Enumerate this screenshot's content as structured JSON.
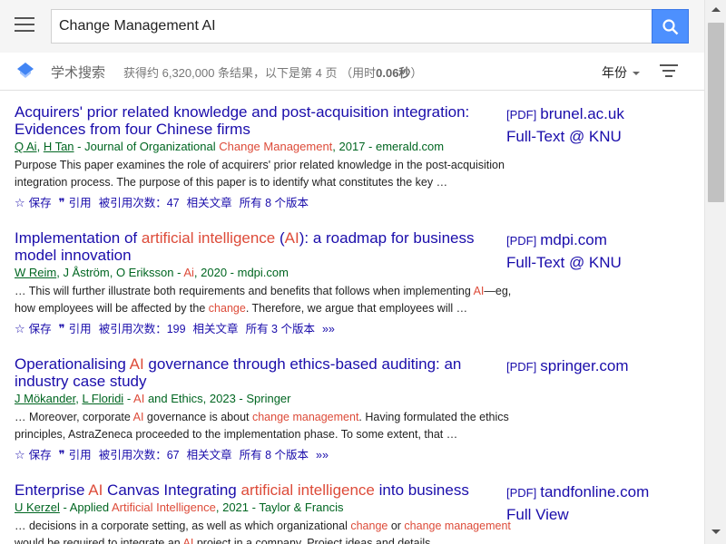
{
  "search": {
    "query": "Change Management AI",
    "button": "search-icon"
  },
  "header": {
    "brand": "学术搜索",
    "stats_prefix": "获得约 6,320,000 条结果，以下是第 4 页 （用时",
    "stats_time": "0.06秒",
    "stats_suffix": "）",
    "year_label": "年份"
  },
  "results": [
    {
      "title": [
        {
          "t": "Acquirers' prior related knowledge and post-acquisition integration: Evidences from four Chinese firms",
          "h": false
        }
      ],
      "authors": [
        {
          "t": "Q Ai",
          "u": true,
          "h": false
        },
        {
          "t": ", ",
          "u": false,
          "h": false
        },
        {
          "t": "H Tan",
          "u": true,
          "h": false
        },
        {
          "t": " - Journal of Organizational ",
          "u": false,
          "h": false
        },
        {
          "t": "Change Management",
          "u": false,
          "h": true
        },
        {
          "t": ", 2017 - emerald.com",
          "u": false,
          "h": false
        }
      ],
      "snippet": [
        {
          "t": "Purpose This paper examines the role of acquirers' prior related knowledge in the post-acquisition integration process. The purpose of this paper is to identify what constitutes the key …",
          "h": false
        }
      ],
      "links": {
        "save": "保存",
        "cite": "引用",
        "cited_by": "被引用次数：47",
        "related": "相关文章",
        "versions": "所有 8 个版本",
        "more": ""
      },
      "side": {
        "pdf": "[PDF]",
        "source": "brunel.ac.uk",
        "extra": "Full-Text @ KNU"
      }
    },
    {
      "title": [
        {
          "t": "Implementation of ",
          "h": false
        },
        {
          "t": "artificial intelligence",
          "h": true
        },
        {
          "t": " (",
          "h": false
        },
        {
          "t": "AI",
          "h": true
        },
        {
          "t": "): a roadmap for business model innovation",
          "h": false
        }
      ],
      "authors": [
        {
          "t": "W Reim",
          "u": true,
          "h": false
        },
        {
          "t": ", J Åström, O Eriksson - ",
          "u": false,
          "h": false
        },
        {
          "t": "Ai",
          "u": false,
          "h": true
        },
        {
          "t": ", 2020 - mdpi.com",
          "u": false,
          "h": false
        }
      ],
      "snippet": [
        {
          "t": "… This will further illustrate both requirements and benefits that follows when implementing ",
          "h": false
        },
        {
          "t": "AI",
          "h": true
        },
        {
          "t": "—eg, how employees will be affected by the ",
          "h": false
        },
        {
          "t": "change",
          "h": true
        },
        {
          "t": ". Therefore, we argue that employees will …",
          "h": false
        }
      ],
      "links": {
        "save": "保存",
        "cite": "引用",
        "cited_by": "被引用次数：199",
        "related": "相关文章",
        "versions": "所有 3 个版本",
        "more": "»»"
      },
      "side": {
        "pdf": "[PDF]",
        "source": "mdpi.com",
        "extra": "Full-Text @ KNU"
      }
    },
    {
      "title": [
        {
          "t": "Operationalising ",
          "h": false
        },
        {
          "t": "AI",
          "h": true
        },
        {
          "t": " governance through ethics-based auditing: an industry case study",
          "h": false
        }
      ],
      "authors": [
        {
          "t": "J Mökander",
          "u": true,
          "h": false
        },
        {
          "t": ", ",
          "u": false,
          "h": false
        },
        {
          "t": "L Floridi",
          "u": true,
          "h": false
        },
        {
          "t": " - ",
          "u": false,
          "h": false
        },
        {
          "t": "AI",
          "u": false,
          "h": true
        },
        {
          "t": " and Ethics, 2023 - Springer",
          "u": false,
          "h": false
        }
      ],
      "snippet": [
        {
          "t": "… Moreover, corporate ",
          "h": false
        },
        {
          "t": "AI",
          "h": true
        },
        {
          "t": " governance is about ",
          "h": false
        },
        {
          "t": "change management",
          "h": true
        },
        {
          "t": ". Having formulated the ethics principles, AstraZeneca proceeded to the implementation phase. To some extent, that …",
          "h": false
        }
      ],
      "links": {
        "save": "保存",
        "cite": "引用",
        "cited_by": "被引用次数：67",
        "related": "相关文章",
        "versions": "所有 8 个版本",
        "more": "»»"
      },
      "side": {
        "pdf": "[PDF]",
        "source": "springer.com",
        "extra": ""
      }
    },
    {
      "title": [
        {
          "t": "Enterprise ",
          "h": false
        },
        {
          "t": "AI",
          "h": true
        },
        {
          "t": " Canvas Integrating ",
          "h": false
        },
        {
          "t": "artificial intelligence",
          "h": true
        },
        {
          "t": " into business",
          "h": false
        }
      ],
      "authors": [
        {
          "t": "U Kerzel",
          "u": true,
          "h": false
        },
        {
          "t": " - Applied ",
          "u": false,
          "h": false
        },
        {
          "t": "Artificial Intelligence",
          "u": false,
          "h": true
        },
        {
          "t": ", 2021 - Taylor & Francis",
          "u": false,
          "h": false
        }
      ],
      "snippet": [
        {
          "t": "… decisions in a corporate setting, as well as which organizational ",
          "h": false
        },
        {
          "t": "change",
          "h": true
        },
        {
          "t": " or ",
          "h": false
        },
        {
          "t": "change management",
          "h": true
        },
        {
          "t": " would be required to integrate an ",
          "h": false
        },
        {
          "t": "AI",
          "h": true
        },
        {
          "t": " project in a company. Project ideas and details …",
          "h": false
        }
      ],
      "links": {
        "save": "",
        "cite": "",
        "cited_by": "",
        "related": "",
        "versions": "",
        "more": ""
      },
      "side": {
        "pdf": "[PDF]",
        "source": "tandfonline.com",
        "extra": "Full View"
      }
    }
  ],
  "colors": {
    "link": "#1a0dab",
    "highlight": "#dd4b39",
    "author": "#006621",
    "accent": "#4d90fe"
  }
}
